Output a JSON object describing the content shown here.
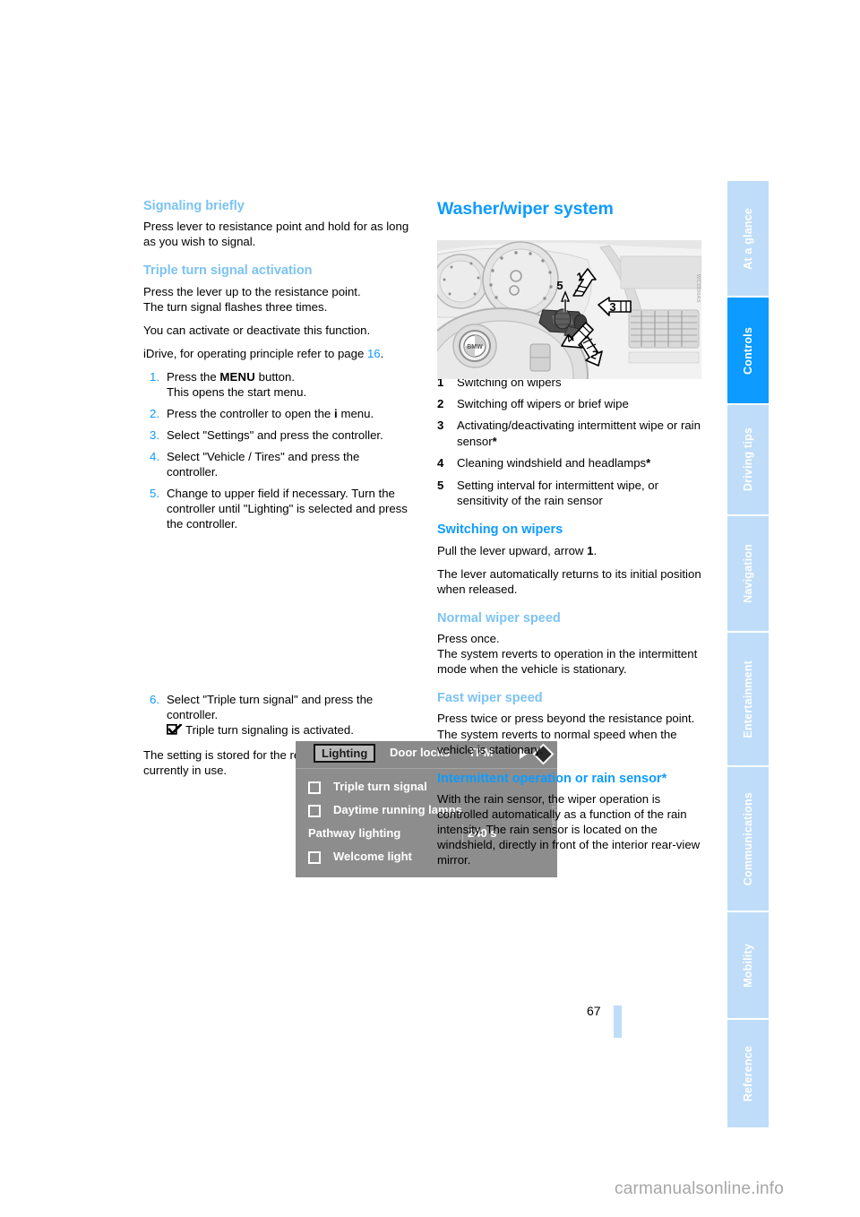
{
  "document": {
    "page_number": "67",
    "watermark": "carmanualsonline.info"
  },
  "sidebar": {
    "tabs": [
      {
        "label": "At a glance",
        "active": false
      },
      {
        "label": "Controls",
        "active": true
      },
      {
        "label": "Driving tips",
        "active": false
      },
      {
        "label": "Navigation",
        "active": false
      },
      {
        "label": "Entertainment",
        "active": false
      },
      {
        "label": "Communications",
        "active": false
      },
      {
        "label": "Mobility",
        "active": false
      },
      {
        "label": "Reference",
        "active": false
      }
    ]
  },
  "left_column": {
    "heading_signaling": "Signaling briefly",
    "para_signaling": "Press lever to resistance point and hold for as long as you wish to signal.",
    "heading_triple": "Triple turn signal activation",
    "para_triple_1": "Press the lever up to the resistance point.",
    "para_triple_2": "The turn signal flashes three times.",
    "para_triple_3": "You can activate or deactivate this function.",
    "idrive_intro_pre": "iDrive, for operating principle refer to page ",
    "idrive_intro_link": "16",
    "idrive_intro_post": ".",
    "steps": [
      {
        "num": "1.",
        "text_pre": "Press the ",
        "bold": "MENU",
        "text_post": " button.",
        "line2": "This opens the start menu."
      },
      {
        "num": "2.",
        "text_pre": "Press the controller to open the ",
        "bold": "i",
        "text_post": " menu.",
        "line2": ""
      },
      {
        "num": "3.",
        "text_pre": "Select \"Settings\" and press the controller.",
        "bold": "",
        "text_post": "",
        "line2": ""
      },
      {
        "num": "4.",
        "text_pre": "Select \"Vehicle / Tires\" and press the controller.",
        "bold": "",
        "text_post": "",
        "line2": ""
      },
      {
        "num": "5.",
        "text_pre": "Change to upper field if necessary. Turn the controller until \"Lighting\" is selected and press the controller.",
        "bold": "",
        "text_post": "",
        "line2": ""
      }
    ],
    "step6": {
      "num": "6.",
      "text": "Select \"Triple turn signal\" and press the controller.",
      "result": "Triple turn signaling is activated."
    },
    "para_stored": "The setting is stored for the remote control currently in use."
  },
  "idrive_screen": {
    "tabs": [
      {
        "label": "Lighting",
        "selected": true
      },
      {
        "label": "Door locks",
        "selected": false
      },
      {
        "label": "TPM",
        "selected": false
      }
    ],
    "rows": [
      {
        "label": "Triple turn signal",
        "checkbox": true,
        "value": ""
      },
      {
        "label": "Daytime running lamps",
        "checkbox": true,
        "value": ""
      },
      {
        "label": "Pathway lighting",
        "checkbox": false,
        "value": "240 s"
      },
      {
        "label": "Welcome light",
        "checkbox": true,
        "value": ""
      }
    ]
  },
  "right_column": {
    "title": "Washer/wiper system",
    "legend": [
      {
        "num": "1",
        "text": "Switching on wipers",
        "asterisk": false
      },
      {
        "num": "2",
        "text": "Switching off wipers or brief wipe",
        "asterisk": false
      },
      {
        "num": "3",
        "text": "Activating/deactivating intermittent wipe or rain sensor",
        "asterisk": true
      },
      {
        "num": "4",
        "text": "Cleaning windshield and headlamps",
        "asterisk": true
      },
      {
        "num": "5",
        "text": "Setting interval for intermittent wipe, or sensitivity of the rain sensor",
        "asterisk": false
      }
    ],
    "heading_switching": "Switching on wipers",
    "para_switching_pre": "Pull the lever upward, arrow ",
    "para_switching_bold": "1",
    "para_switching_post": ".",
    "para_switching_2": "The lever automatically returns to its initial position when released.",
    "heading_normal": "Normal wiper speed",
    "para_normal_1": "Press once.",
    "para_normal_2": "The system reverts to operation in the intermittent mode when the vehicle is stationary.",
    "heading_fast": "Fast wiper speed",
    "para_fast_1": "Press twice or press beyond the resistance point.",
    "para_fast_2": "The system reverts to normal speed when the vehicle is stationary.",
    "heading_intermittent": "Intermittent operation or rain sensor*",
    "para_intermittent": "With the rain sensor, the wiper operation is controlled automatically as a function of the rain intensity. The rain sensor is located on the windshield, directly in front of the interior rear-view mirror."
  },
  "figure_wheel": {
    "callouts": [
      "1",
      "2",
      "3",
      "4",
      "5"
    ],
    "code": "WC2300AS"
  },
  "colors": {
    "accent_blue": "#0d9bff",
    "light_blue": "#7cc3f2",
    "tab_inactive": "#bfddf8"
  }
}
